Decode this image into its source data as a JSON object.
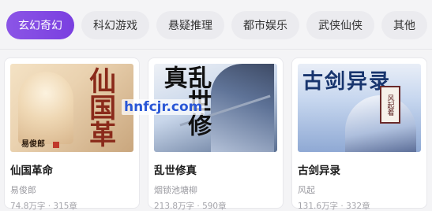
{
  "tabs": [
    {
      "label": "玄幻奇幻",
      "active": true
    },
    {
      "label": "科幻游戏",
      "active": false
    },
    {
      "label": "悬疑推理",
      "active": false
    },
    {
      "label": "都市娱乐",
      "active": false
    },
    {
      "label": "武侠仙侠",
      "active": false
    },
    {
      "label": "其他",
      "active": false
    }
  ],
  "books": [
    {
      "title": "仙国革命",
      "author": "易俊郎",
      "meta": "74.8万字 · 315章",
      "cover_title": "仙国革",
      "cover_author": "易俊郎"
    },
    {
      "title": "乱世修真",
      "author": "烟锁池塘柳",
      "meta": "213.8万字 · 590章",
      "cover_title": "乱世修真"
    },
    {
      "title": "古剑异录",
      "author": "风起",
      "meta": "131.6万字 · 332章",
      "cover_title": "古剑异录",
      "cover_seal": "风起着"
    }
  ],
  "watermark": "hnfcjr.com",
  "colors": {
    "accent": "#7a3fe0",
    "tab_bg": "#ebebef",
    "page_bg": "#f4f4f6"
  }
}
